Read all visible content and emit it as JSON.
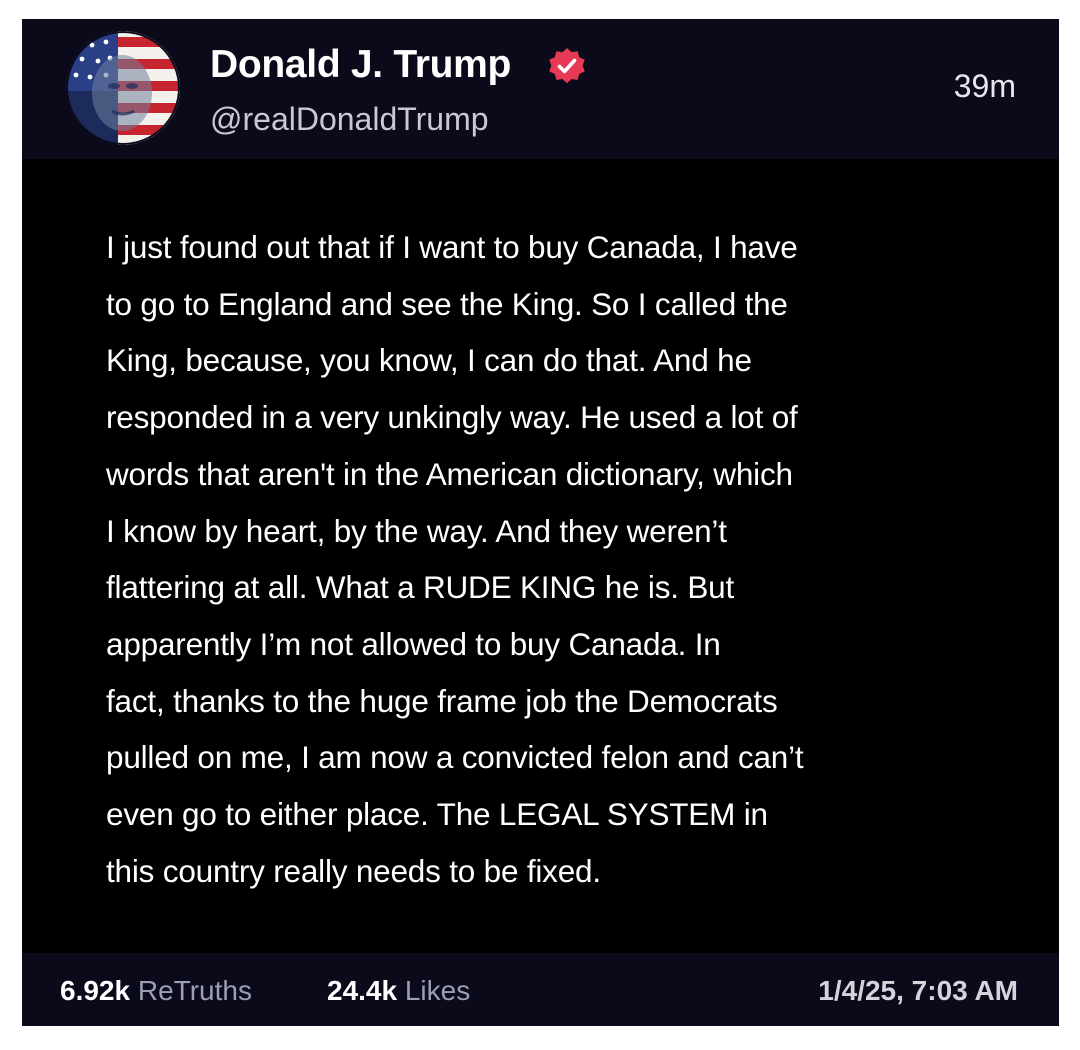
{
  "author": {
    "name": "Donald J. Trump",
    "handle": "@realDonaldTrump",
    "verified": true,
    "avatar_icon": "flag-portrait-avatar",
    "verified_icon": "verified-badge-icon",
    "verified_color": "#e73a56"
  },
  "post": {
    "age": "39m",
    "lines": [
      "I just found out that if I want to buy Canada, I have",
      "to go to England and see the King. So I called the",
      "King, because, you know, I can do that. And he",
      "responded in a very unkingly way. He used a lot of",
      "words that aren't in the American dictionary, which",
      "I know by heart, by the way.  And they weren’t",
      "flattering at all. What a RUDE KING he is. But",
      "apparently I’m not allowed to buy Canada. In",
      "fact, thanks to the huge frame job the Democrats",
      "pulled on me, I am now a convicted felon and can’t",
      "even go to either place. The LEGAL SYSTEM in",
      "this country really needs to be fixed."
    ]
  },
  "stats": {
    "retruths_count": "6.92k",
    "retruths_label": "ReTruths",
    "likes_count": "24.4k",
    "likes_label": "Likes",
    "date": "1/4/25, 7:03 AM"
  },
  "colors": {
    "background": "#000000",
    "header_background": "#0b0a1a",
    "text": "#ffffff",
    "muted_text": "#9d9db3"
  }
}
